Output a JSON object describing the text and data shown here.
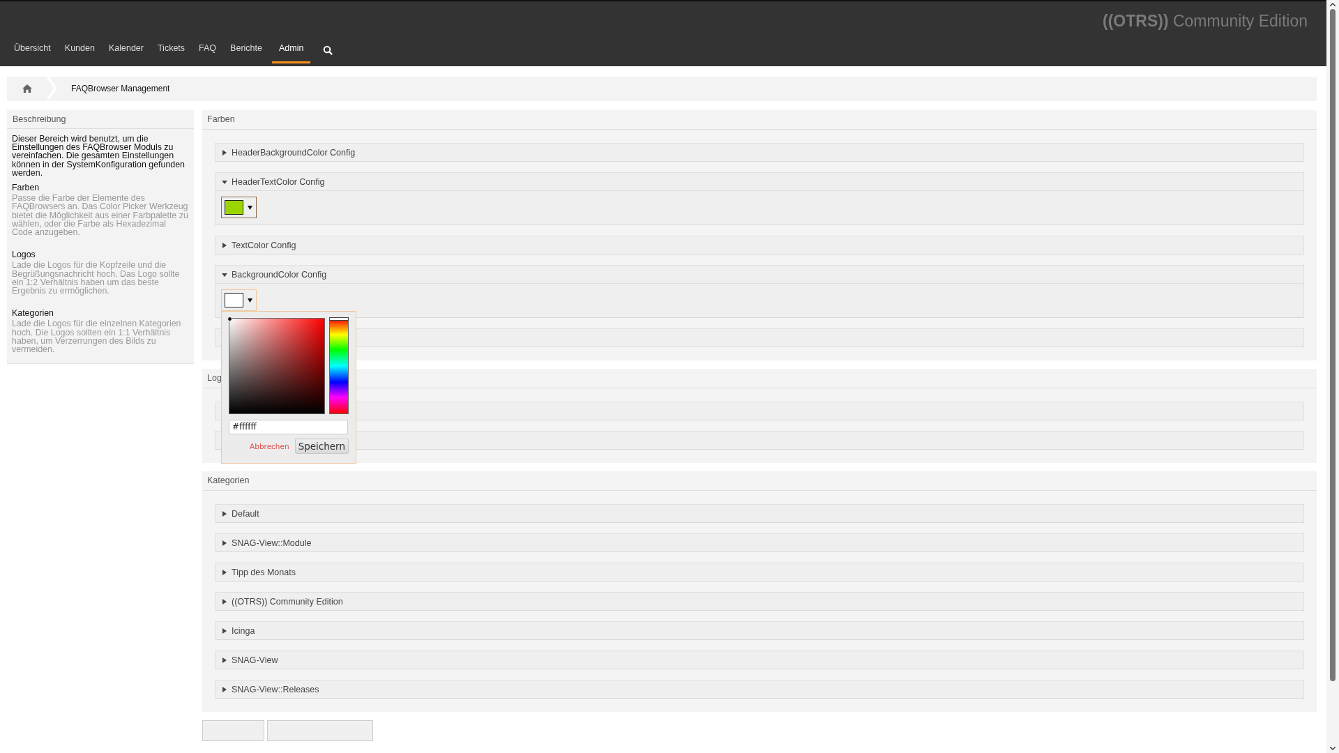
{
  "header": {
    "logo_bold": "((OTRS))",
    "logo_rest": "Community Edition"
  },
  "nav": [
    {
      "label": "Übersicht",
      "selected": false
    },
    {
      "label": "Kunden",
      "selected": false
    },
    {
      "label": "Kalender",
      "selected": false
    },
    {
      "label": "Tickets",
      "selected": false
    },
    {
      "label": "FAQ",
      "selected": false
    },
    {
      "label": "Berichte",
      "selected": false
    },
    {
      "label": "Admin",
      "selected": true
    }
  ],
  "breadcrumb": {
    "current": "FAQBrowser Management"
  },
  "sidebar": {
    "title": "Beschreibung",
    "intro": "Dieser Bereich wird benutzt, um die Einstellungen des FAQBrowser Moduls zu vereinfachen. Die gesamten Einstellungen können in der SystemKonfiguration gefunden werden.",
    "sections": [
      {
        "heading": "Farben",
        "text": "Passe die Farbe der Elemente des FAQBrowsers an. Das Color Picker Werkzeug bietet die Möglichkeit aus einer Farbpalette zu wählen, oder die Farbe als Hexadezimal Code anzugeben."
      },
      {
        "heading": "Logos",
        "text": "Lade die Logos für die Kopfzeile und die Begrüßungsnachricht hoch. Das Logo sollte ein 1:2 Verhältnis haben um das beste Ergebnis zu ermöglichen."
      },
      {
        "heading": "Kategorien",
        "text": "Lade die Logos für die einzelnen Kategorien hoch. Die Logos sollten ein 1:1 Verhältnis haben, um Verzerrungen des Bilds zu vermeiden."
      }
    ]
  },
  "panels": [
    {
      "title": "Farben",
      "items": [
        {
          "kind": "config",
          "label": "HeaderBackgroundColor Config",
          "expanded": false
        },
        {
          "kind": "config",
          "label": "HeaderTextColor Config",
          "expanded": true,
          "color": "#99d600",
          "picker_open": false
        },
        {
          "kind": "config",
          "label": "TextColor Config",
          "expanded": false
        },
        {
          "kind": "config",
          "label": "BackgroundColor Config",
          "expanded": true,
          "color": "#ffffff",
          "picker_open": true
        },
        {
          "kind": "covered"
        }
      ]
    },
    {
      "title": "Log",
      "items": [
        {
          "kind": "covered"
        },
        {
          "kind": "covered"
        }
      ]
    },
    {
      "title": "Kategorien",
      "items": [
        {
          "kind": "config",
          "label": "Default",
          "expanded": false
        },
        {
          "kind": "config",
          "label": "SNAG-View::Module",
          "expanded": false
        },
        {
          "kind": "config",
          "label": "Tipp des Monats",
          "expanded": false
        },
        {
          "kind": "config",
          "label": "((OTRS)) Community Edition",
          "expanded": false
        },
        {
          "kind": "config",
          "label": "Icinga",
          "expanded": false
        },
        {
          "kind": "config",
          "label": "SNAG-View",
          "expanded": false
        },
        {
          "kind": "config",
          "label": "SNAG-View::Releases",
          "expanded": false
        }
      ]
    }
  ],
  "color_picker": {
    "value": "#ffffff",
    "hue": {
      "level": 0
    },
    "cancel": "Abbrechen",
    "save": "Speichern"
  }
}
